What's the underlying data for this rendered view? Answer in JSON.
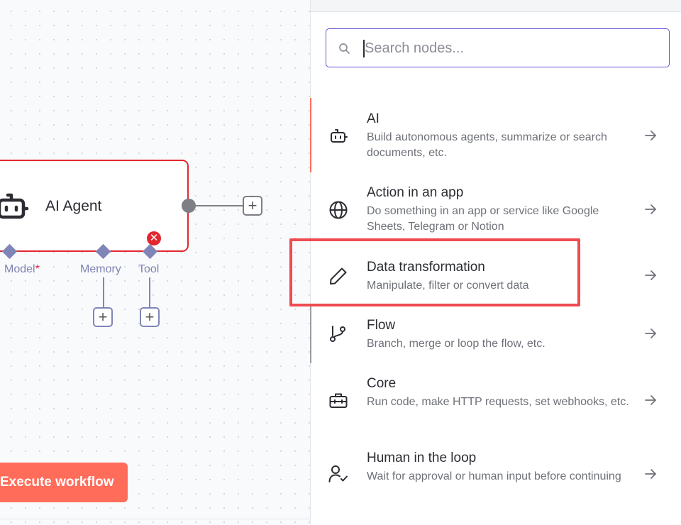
{
  "canvas": {
    "agent_node": {
      "title": "AI Agent",
      "error_symbol": "✕"
    },
    "connectors": [
      {
        "label": "Model",
        "required": "*"
      },
      {
        "label": "Memory"
      },
      {
        "label": "Tool"
      }
    ],
    "add_symbol": "+",
    "execute_button": "Execute workflow"
  },
  "panel": {
    "search": {
      "placeholder": "Search nodes...",
      "value": ""
    },
    "categories": [
      {
        "icon": "robot-icon",
        "title": "AI",
        "description": "Build autonomous agents, summarize or search documents, etc."
      },
      {
        "icon": "globe-icon",
        "title": "Action in an app",
        "description": "Do something in an app or service like Google Sheets, Telegram or Notion"
      },
      {
        "icon": "pencil-icon",
        "title": "Data transformation",
        "description": "Manipulate, filter or convert data"
      },
      {
        "icon": "git-branch-icon",
        "title": "Flow",
        "description": "Branch, merge or loop the flow, etc."
      },
      {
        "icon": "toolbox-icon",
        "title": "Core",
        "description": "Run code, make HTTP requests, set webhooks, etc."
      },
      {
        "icon": "user-check-icon",
        "title": "Human in the loop",
        "description": "Wait for approval or human input before continuing"
      }
    ]
  },
  "colors": {
    "accent": "#ff6d5a",
    "error": "#e3262f",
    "connector": "#8085b8",
    "search_focus": "#5f54d6",
    "highlight": "#ef4b50"
  }
}
